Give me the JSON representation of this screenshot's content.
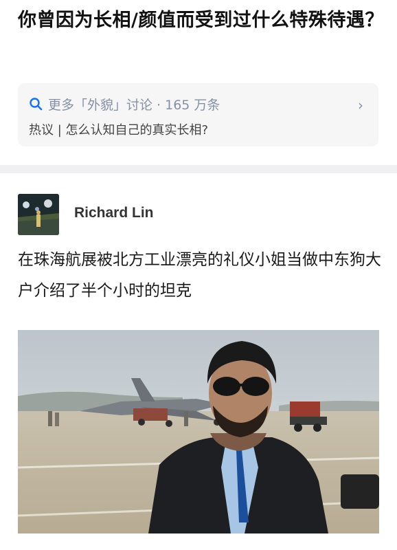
{
  "question": {
    "title": "你曾因为长相/颜值而受到过什么特殊待遇？"
  },
  "topic": {
    "line1": "更多「外貌」讨论 · 165 万条",
    "line2": "热议 | 怎么认知自己的真实长相?",
    "icon": "search-icon",
    "chevron": "›",
    "accent": "#8590a6"
  },
  "answer": {
    "author": "Richard Lin",
    "content": "在珠海航展被北方工业漂亮的礼仪小姐当做中东狗大户介绍了半个小时的坦克"
  },
  "colors": {
    "background": "#ffffff",
    "card": "#f6f6f6",
    "divider": "#f0f0f2"
  }
}
